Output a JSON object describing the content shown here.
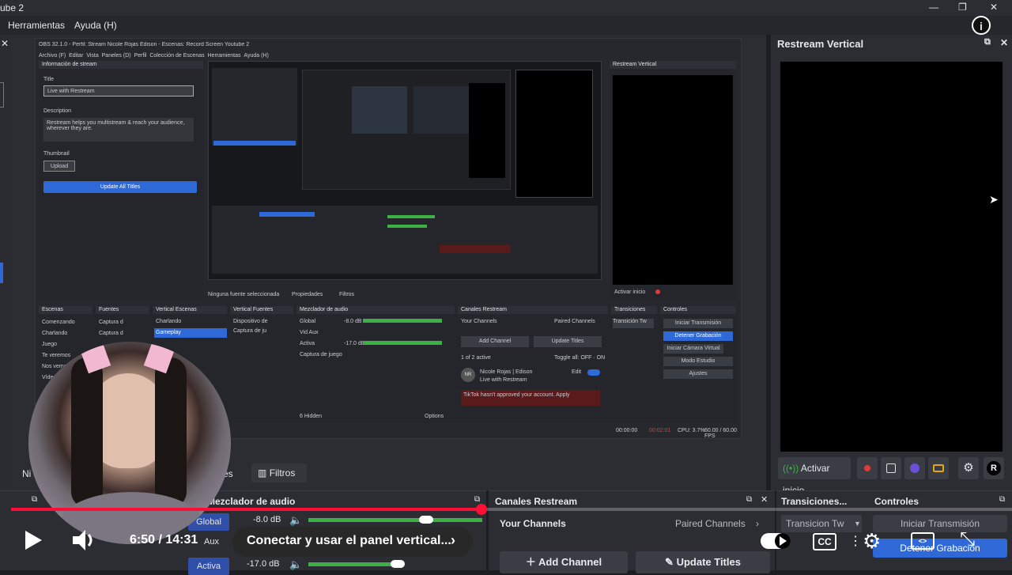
{
  "window": {
    "title_fragment": "ube 2",
    "controls": [
      "—",
      "❐",
      "✕"
    ]
  },
  "menu": [
    "Herramientas",
    "Ayuda (H)"
  ],
  "nested_obs": {
    "title": "OBS 32.1.0 - Perfil: Stream Nicole Rojas Edison - Escenas: Record Screen Youtube 2",
    "menu": [
      "Archivo (F)",
      "Editar",
      "Vista",
      "Paneles (D)",
      "Perfil",
      "Colección de Escenas",
      "Herramientas",
      "Ayuda (H)"
    ],
    "stream_info": {
      "header": "Información de stream",
      "title_label": "Title",
      "title_value": "Live with Restream",
      "description_label": "Description",
      "description_value": "Restream helps you multistream & reach your audience, wherever they are.",
      "thumbnail_label": "Thumbnail",
      "upload": "Upload",
      "update_all": "Update All Titles"
    },
    "restream_vertical": "Restream Vertical",
    "activate_label": "Activar inicio",
    "no_source": "Ninguna fuente seleccionada",
    "propiedades": "Propiedades",
    "filtros": "Filtros",
    "docks": {
      "escenas": {
        "title": "Escenas",
        "items": [
          "Comenzando",
          "Charlando",
          "Juego",
          "Te veremos",
          "Nos vemos",
          "Vídeo"
        ]
      },
      "fuentes": {
        "title": "Fuentes",
        "items": [
          "Captura d",
          "Captura d"
        ]
      },
      "vertical_escenas": {
        "title": "Vertical Escenas",
        "items": [
          "Charlando",
          "Gameplay"
        ]
      },
      "vertical_fuentes": {
        "title": "Vertical Fuentes",
        "items": [
          "Dispositivo de",
          "Captura de ju"
        ]
      },
      "mezclador": {
        "title": "Mezclador de audio",
        "rows": [
          {
            "name": "Global",
            "db": "-8.0 dB"
          },
          {
            "name": "Vid Aux",
            "db": ""
          },
          {
            "name": "Activa",
            "db": "-17.0 dB"
          },
          {
            "name": "Captura de juego",
            "db": ""
          }
        ],
        "footer": "6 Hidden",
        "options": "Options"
      },
      "canales": {
        "title": "Canales Restream",
        "your_channels": "Your Channels",
        "paired": "Paired Channels",
        "add": "Add Channel",
        "update": "Update Titles",
        "toggle_all": "Toggle all: OFF · ON",
        "channel_name": "Nicole Rojas | Edison",
        "channel_sub": "Live with Restream",
        "edit": "Edit",
        "warning": "TikTok hasn't approved your account.",
        "apply": "Apply",
        "enabled_label": "1 of 2 active"
      },
      "transiciones": {
        "title": "Transiciones",
        "value": "Transición Tw"
      },
      "controles": {
        "title": "Controles",
        "buttons": [
          "Iniciar Transmisión",
          "Detener Grabación",
          "Iniciar Cámara Virtual",
          "Modo Estudio",
          "Ajustes"
        ]
      }
    },
    "status": {
      "rec": "00:02:01",
      "cpu": "CPU: 3.7%",
      "fps": "60.00 / 60.00 FPS",
      "time": "00:00:00"
    }
  },
  "right_panel": {
    "title": "Restream Vertical",
    "activate_label": "Activar inicio",
    "logo": "R"
  },
  "bottom_docks": {
    "mezclador_title": "Mezclador de audio",
    "mixer_rows": [
      {
        "name": "Global",
        "db": "-8.0 dB"
      },
      {
        "name": "Aux",
        "db": ""
      },
      {
        "name": "Activa",
        "db": "-17.0 dB"
      }
    ],
    "canales_title": "Canales Restream",
    "your_channels": "Your Channels",
    "paired_channels": "Paired Channels",
    "add_channel": "Add Channel",
    "update_titles": "Update Titles",
    "transiciones_title": "Transiciones...",
    "transition_value": "Transicion Tw",
    "controles_title": "Controles",
    "iniciar_transmision": "Iniciar Transmisión",
    "detener_grabacion": "Detener Grabación",
    "filtros": "Filtros",
    "propiedades_partial": "es",
    "left_partial": "Ni"
  },
  "player": {
    "time": "6:50 / 14:31",
    "chapter": "Conectar y usar el panel vertical...",
    "progress": 0.47,
    "cc": "CC"
  },
  "colors": {
    "accent": "#2f69d8",
    "progress": "#ff0f38",
    "panel": "#2b2d33",
    "record": "#e53935"
  }
}
